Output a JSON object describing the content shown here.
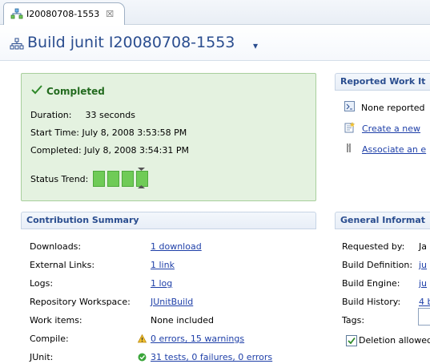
{
  "tab": {
    "label": "I20080708-1553",
    "close": "☒"
  },
  "header": {
    "title": "Build junit I20080708-1553",
    "caret": "▾"
  },
  "status": {
    "heading": "Completed",
    "duration_label": "Duration:",
    "duration_value": "33 seconds",
    "start_label": "Start Time:",
    "start_value": "July 8, 2008 3:53:58 PM",
    "completed_label": "Completed:",
    "completed_value": "July 8, 2008 3:54:31 PM",
    "trend_label": "Status Trend:"
  },
  "contribution": {
    "title": "Contribution Summary",
    "rows": [
      {
        "label": "Downloads:",
        "value": "1 download",
        "link": true
      },
      {
        "label": "External Links:",
        "value": "1 link",
        "link": true
      },
      {
        "label": "Logs:",
        "value": "1 log",
        "link": true
      },
      {
        "label": "Repository Workspace:",
        "value": "JUnitBuild",
        "link": true
      },
      {
        "label": "Work items:",
        "value": "None included",
        "link": false
      },
      {
        "label": "Compile:",
        "value": "0 errors, 15 warnings",
        "link": true
      },
      {
        "label": "JUnit:",
        "value": "31 tests, 0 failures, 0 errors",
        "link": true
      }
    ]
  },
  "reported": {
    "title": "Reported Work It",
    "none": "None reported",
    "create": "Create a new",
    "associate": "Associate an e"
  },
  "general": {
    "title": "General Informat",
    "requested_label": "Requested by:",
    "requested_value": "Ja",
    "definition_label": "Build Definition:",
    "definition_value": "ju",
    "engine_label": "Build Engine:",
    "engine_value": "ju",
    "history_label": "Build History:",
    "history_value": "4 b",
    "tags_label": "Tags:",
    "deletion_label": "Deletion allowed"
  },
  "colors": {
    "accent": "#2a4d8f",
    "success": "#236b1f",
    "link": "#1e3fa8",
    "status_bg": "#e4f2e0"
  },
  "icons": [
    "build-icon",
    "close-icon",
    "checkmark-icon",
    "warning-icon",
    "success-icon"
  ]
}
